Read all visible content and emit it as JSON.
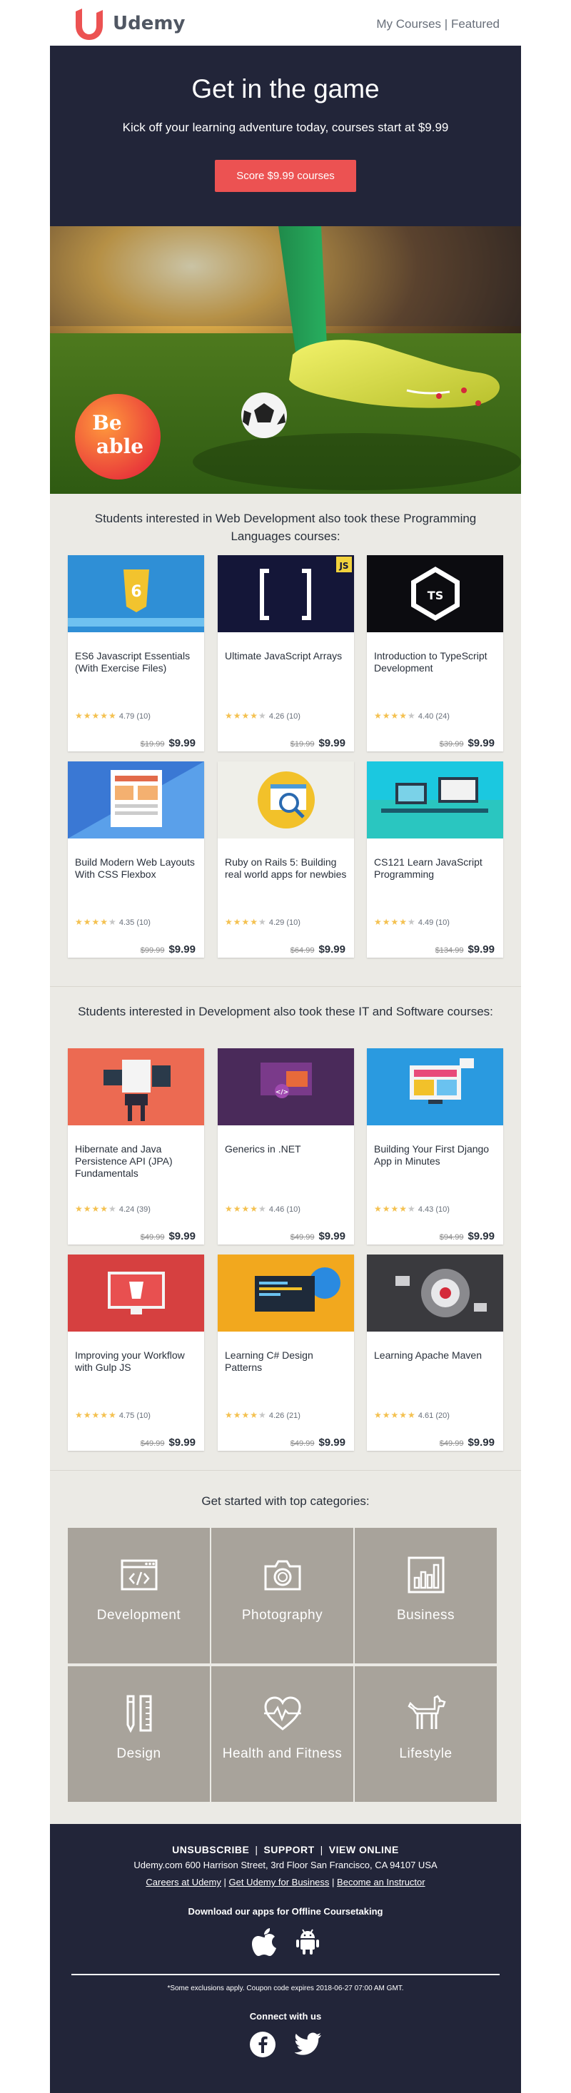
{
  "brand": {
    "name": "Udemy",
    "accent": "#ec5252",
    "dark": "#222539"
  },
  "topnav": {
    "my_courses": "My Courses",
    "separator": "|",
    "featured": "Featured"
  },
  "hero": {
    "title": "Get in the game",
    "subtitle": "Kick off your learning adventure today, courses start at $9.99",
    "cta": "Score $9.99 courses"
  },
  "banner": {
    "badge_line1": "Be",
    "badge_line2": "able"
  },
  "section1": {
    "title": "Students interested in Web Development also took these Programming Languages courses:",
    "courses": [
      {
        "title": "ES6 Javascript Essentials (With Exercise Files)",
        "rating": "4.79",
        "reviews": "(10)",
        "stars": 5,
        "old_price": "$19.99",
        "price": "$9.99"
      },
      {
        "title": "Ultimate JavaScript Arrays",
        "rating": "4.26",
        "reviews": "(10)",
        "stars": 4,
        "old_price": "$19.99",
        "price": "$9.99"
      },
      {
        "title": "Introduction to TypeScript Development",
        "rating": "4.40",
        "reviews": "(24)",
        "stars": 4,
        "old_price": "$39.99",
        "price": "$9.99"
      },
      {
        "title": "Build Modern Web Layouts With CSS Flexbox",
        "rating": "4.35",
        "reviews": "(10)",
        "stars": 4,
        "old_price": "$99.99",
        "price": "$9.99"
      },
      {
        "title": "Ruby on Rails 5: Building real world apps for newbies",
        "rating": "4.29",
        "reviews": "(10)",
        "stars": 4,
        "old_price": "$64.99",
        "price": "$9.99"
      },
      {
        "title": "CS121 Learn JavaScript Programming",
        "rating": "4.49",
        "reviews": "(10)",
        "stars": 4,
        "old_price": "$134.99",
        "price": "$9.99"
      }
    ]
  },
  "section2": {
    "title": "Students interested in Development also took these IT and Software courses:",
    "courses": [
      {
        "title": "Hibernate and Java Persistence API (JPA) Fundamentals",
        "rating": "4.24",
        "reviews": "(39)",
        "stars": 4,
        "old_price": "$49.99",
        "price": "$9.99"
      },
      {
        "title": "Generics in .NET",
        "rating": "4.46",
        "reviews": "(10)",
        "stars": 4,
        "old_price": "$49.99",
        "price": "$9.99"
      },
      {
        "title": "Building Your First Django App in Minutes",
        "rating": "4.43",
        "reviews": "(10)",
        "stars": 4,
        "old_price": "$94.99",
        "price": "$9.99"
      },
      {
        "title": "Improving your Workflow with Gulp JS",
        "rating": "4.75",
        "reviews": "(10)",
        "stars": 5,
        "old_price": "$49.99",
        "price": "$9.99"
      },
      {
        "title": "Learning C# Design Patterns",
        "rating": "4.26",
        "reviews": "(21)",
        "stars": 4,
        "old_price": "$49.99",
        "price": "$9.99"
      },
      {
        "title": "Learning Apache Maven",
        "rating": "4.61",
        "reviews": "(20)",
        "stars": 5,
        "old_price": "$49.99",
        "price": "$9.99"
      }
    ]
  },
  "categories": {
    "title": "Get started with top categories:",
    "items": [
      {
        "label": "Development",
        "icon": "code-window-icon"
      },
      {
        "label": "Photography",
        "icon": "camera-icon"
      },
      {
        "label": "Business",
        "icon": "bar-chart-icon"
      },
      {
        "label": "Design",
        "icon": "pencil-ruler-icon"
      },
      {
        "label": "Health and Fitness",
        "icon": "heart-pulse-icon"
      },
      {
        "label": "Lifestyle",
        "icon": "dog-icon"
      }
    ]
  },
  "footer": {
    "unsubscribe": "UNSUBSCRIBE",
    "support": "SUPPORT",
    "view_online": "VIEW ONLINE",
    "sep": "|",
    "address": "Udemy.com 600 Harrison Street, 3rd Floor San Francisco, CA 94107 USA",
    "careers": "Careers at Udemy",
    "business": "Get Udemy for Business",
    "instructor": "Become an Instructor",
    "apps_title": "Download our apps for Offline Coursetaking",
    "note": "*Some exclusions apply. Coupon code expires 2018-06-27 07:00 AM GMT.",
    "connect": "Connect with us"
  }
}
